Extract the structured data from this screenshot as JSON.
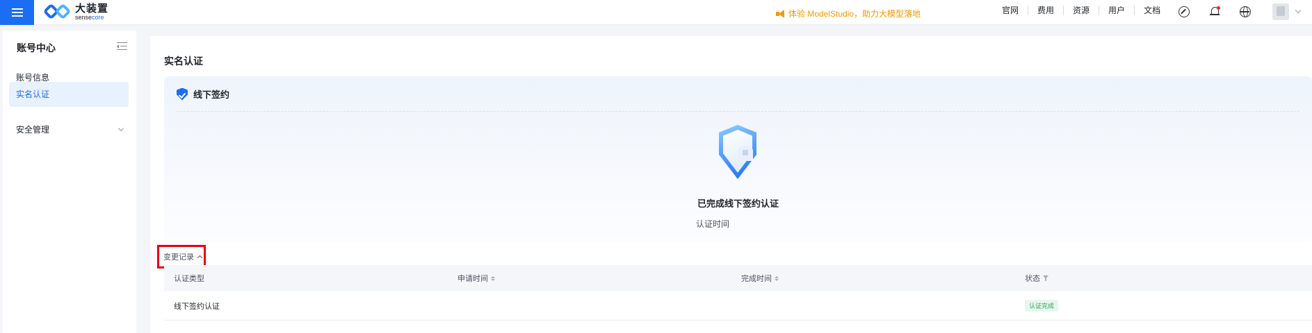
{
  "topbar": {
    "logo_cn": "大装置",
    "logo_en_a": "sense",
    "logo_en_b": "core",
    "promo": "体验 ModelStudio，助力大模型落地",
    "links": [
      "官网",
      "费用",
      "资源",
      "用户",
      "文档"
    ],
    "icons": [
      "menu-icon",
      "compass-icon",
      "bell-icon",
      "globe-icon",
      "avatar"
    ]
  },
  "sidebar": {
    "title": "账号中心",
    "items": [
      {
        "label": "账号信息"
      },
      {
        "label": "实名认证"
      },
      {
        "label": "安全管理"
      }
    ]
  },
  "main": {
    "page_title": "实名认证",
    "card_title": "线下签约",
    "done_title": "已完成线下签约认证",
    "cert_time_label": "认证时间",
    "history_label": "变更记录",
    "table": {
      "headers": [
        "认证类型",
        "申请时间",
        "完成时间",
        "状态"
      ],
      "rows": [
        {
          "type": "线下签约认证",
          "apply_time": "",
          "done_time": "",
          "status": "认证完成"
        }
      ]
    }
  },
  "colors": {
    "accent": "#1b6ef3",
    "promo": "#f39800",
    "highlight_box": "#e60012",
    "status_ok": "#2ea35a"
  }
}
